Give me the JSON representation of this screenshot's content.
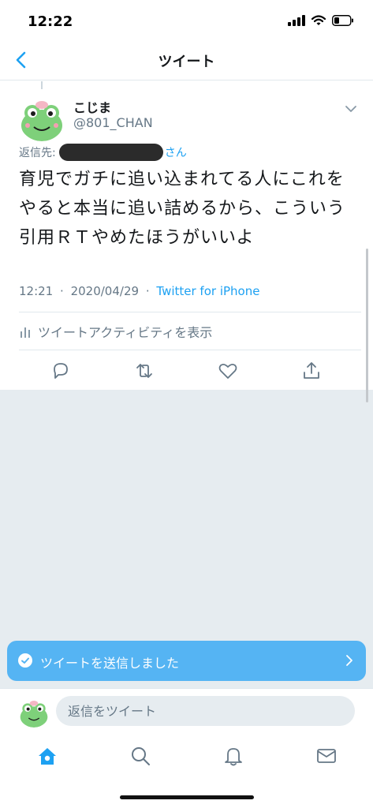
{
  "status_bar": {
    "time": "12:22"
  },
  "nav": {
    "title": "ツイート"
  },
  "tweet": {
    "display_name": "こじま",
    "handle": "@801_CHAN",
    "reply_prefix": "返信先:",
    "reply_suffix": "さん",
    "text": "育児でガチに追い込まれてる人にこれをやると本当に追い詰めるから、こういう引用ＲＴやめたほうがいいよ",
    "time": "12:21",
    "date": "2020/04/29",
    "separator": "·",
    "source": "Twitter for iPhone",
    "activity_label": "ツイートアクティビティを表示"
  },
  "toast": {
    "message": "ツイートを送信しました"
  },
  "reply_bar": {
    "placeholder": "返信をツイート"
  },
  "colors": {
    "accent": "#1da1f2",
    "toast": "#55b4f3",
    "filler": "#e6ecf0",
    "muted": "#657786"
  },
  "icons": {
    "nav_back": "chevron-left-icon",
    "tweet_menu": "chevron-down-icon",
    "actions": [
      "reply-icon",
      "retweet-icon",
      "like-icon",
      "share-icon"
    ],
    "tabs": [
      "home-icon",
      "search-icon",
      "notifications-icon",
      "messages-icon"
    ]
  }
}
